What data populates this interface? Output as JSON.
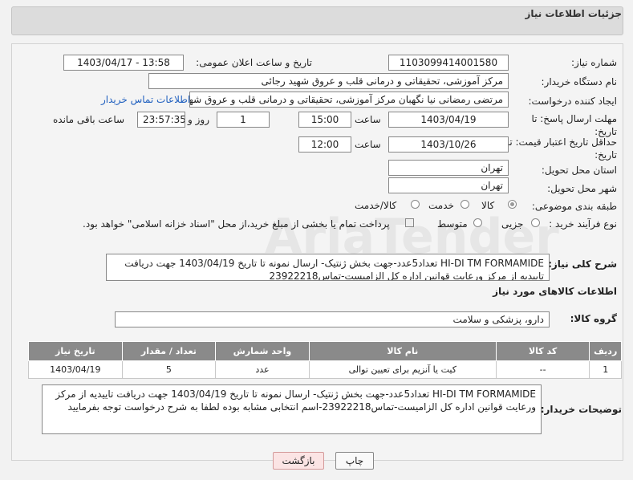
{
  "header": {
    "title": "جزئیات اطلاعات نیاز"
  },
  "fields": {
    "need_number_label": "شماره نیاز:",
    "need_number": "1103099414001580",
    "announce_label": "تاریخ و ساعت اعلان عمومی:",
    "announce_value": "1403/04/17 - 13:58",
    "buyer_org_label": "نام دستگاه خریدار:",
    "buyer_org": "مرکز آموزشی، تحقیقاتی و درمانی قلب و عروق شهید رجائی",
    "requester_label": "ایجاد کننده درخواست:",
    "requester": "مرتضی رمضانی نیا نگهبان مرکز آموزشی، تحقیقاتی و درمانی قلب و عروق شهید رجائی",
    "contact_link": "اطلاعات تماس خریدار",
    "reply_deadline_label": "مهلت ارسال پاسخ: تا تاریخ:",
    "reply_date": "1403/04/19",
    "time_label": "ساعت",
    "reply_time": "15:00",
    "days_value": "1",
    "day_and_label": "روز و",
    "remaining_time": "23:57:35",
    "remaining_label": "ساعت باقی مانده",
    "price_validity_label": "حداقل تاریخ اعتبار قیمت: تا تاریخ:",
    "price_date": "1403/10/26",
    "price_time_label": "ساعت",
    "price_time": "12:00",
    "province_label": "استان محل تحویل:",
    "province": "تهران",
    "city_label": "شهر محل تحویل:",
    "city": "تهران",
    "category_label": "طبقه بندی موضوعی:",
    "category_options": [
      "کالا",
      "خدمت",
      "کالا/خدمت"
    ],
    "process_label": "نوع فرآیند خرید :",
    "process_options": [
      "جزیی",
      "متوسط"
    ],
    "payment_note": "پرداخت تمام یا بخشی از مبلغ خرید،از محل \"اسناد خزانه اسلامی\" خواهد بود.",
    "description_label": "شرح کلی نیاز:",
    "description": "HI-DI TM FORMAMIDE تعداد5عدد-جهت بخش ژنتیک- ارسال نمونه تا تاریخ 1403/04/19 جهت دریافت تاییدیه از مرکز ورعایت قوانین اداره کل الزامیست-تماس23922218",
    "goods_info_title": "اطلاعات کالاهای مورد نیاز",
    "goods_group_label": "گروه کالا:",
    "goods_group": "دارو، پزشکی و سلامت"
  },
  "table": {
    "headers": [
      "ردیف",
      "کد کالا",
      "نام کالا",
      "واحد شمارش",
      "تعداد / مقدار",
      "تاریخ نیاز"
    ],
    "rows": [
      [
        "1",
        "--",
        "کیت یا آنزیم برای تعیین توالی",
        "عدد",
        "5",
        "1403/04/19"
      ]
    ]
  },
  "buyer_notes": {
    "label": "توضیحات خریدار:",
    "text": "HI-DI TM FORMAMIDE تعداد5عدد-جهت بخش ژنتیک- ارسال نمونه تا تاریخ 1403/04/19 جهت دریافت تاییدیه از مرکز ورعایت قوانین اداره کل الزامیست-تماس23922218-اسم انتخابی مشابه بوده لطفا به شرح درخواست توجه بفرمایید"
  },
  "buttons": {
    "print": "چاپ",
    "back": "بازگشت"
  }
}
